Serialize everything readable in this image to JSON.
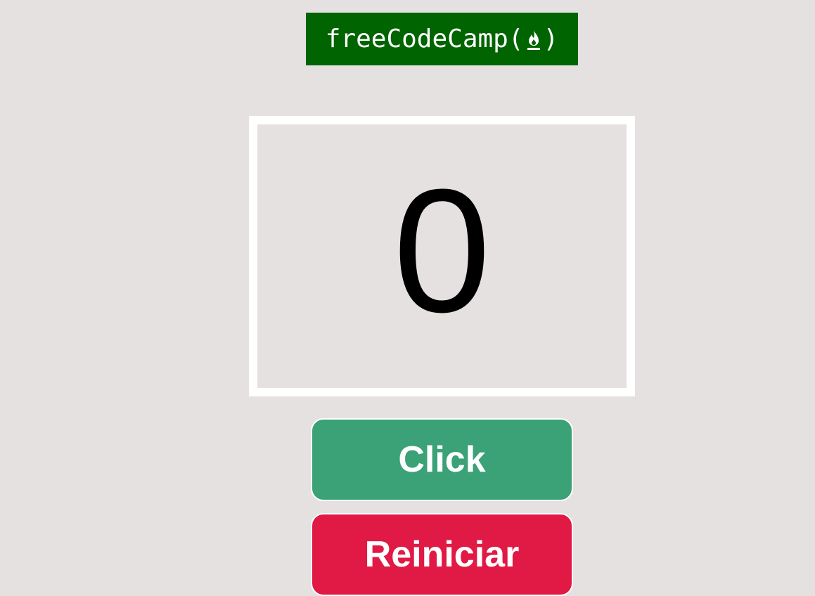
{
  "logo": {
    "text_before": "freeCodeCamp(",
    "text_after": ")",
    "icon": "fire-icon",
    "background": "#006400"
  },
  "counter": {
    "value": "0"
  },
  "buttons": {
    "click_label": "Click",
    "reset_label": "Reiniciar"
  },
  "colors": {
    "page_background": "#e6e1e1",
    "click_button": "#3aa276",
    "reset_button": "#e01a45",
    "counter_border": "#ffffff"
  }
}
